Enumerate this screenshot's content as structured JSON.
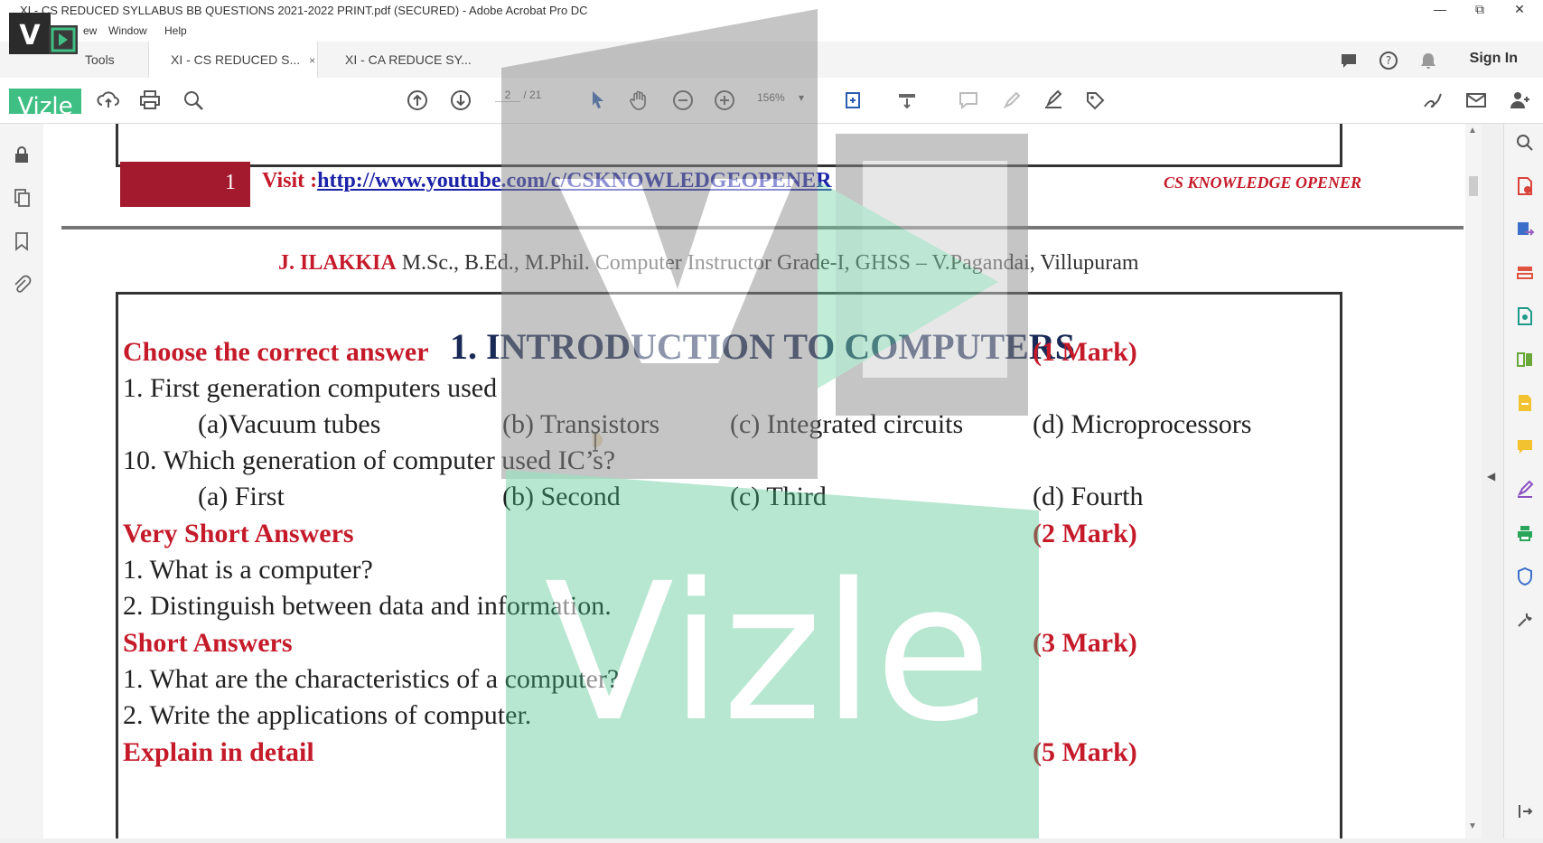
{
  "window": {
    "title": "XI - CS REDUCED SYLLABUS BB QUESTIONS 2021-2022 PRINT.pdf (SECURED) - Adobe Acrobat Pro DC",
    "minimize": "—",
    "maximize": "⧉",
    "close": "✕"
  },
  "menu": {
    "view": "ew",
    "window": "Window",
    "help": "Help"
  },
  "tabs": {
    "tools": "Tools",
    "doc1": "XI - CS REDUCED S...",
    "doc1_close": "×",
    "doc2": "XI - CA REDUCE SY..."
  },
  "header": {
    "sign_in": "Sign In"
  },
  "toolbar": {
    "page_current": "2",
    "page_total": "/ 21",
    "zoom": "156%"
  },
  "watermark": {
    "brand": "Vizle",
    "logo_letter": "V",
    "accent": "#3fbf84"
  },
  "document": {
    "page_number": "1",
    "visit_prefix": "Visit :",
    "visit_link": "http://www.youtube.com/c/CSKNOWLEDGEOPENER",
    "channel": "CS KNOWLEDGE OPENER",
    "author_name": "J. ILAKKIA",
    "author_details": "M.Sc., B.Ed., M.Phil. Computer Instructor Grade-I, GHSS – V.Pagandai, Villupuram",
    "chapter_title": "1. INTRODUCTION TO COMPUTERS",
    "sections": {
      "choose": {
        "title": "Choose the correct answer",
        "marks": "(1 Mark)"
      },
      "very_short": {
        "title": "Very Short Answers",
        "marks": "(2 Mark)"
      },
      "short": {
        "title": "Short Answers",
        "marks": "(3 Mark)"
      },
      "explain": {
        "title": "Explain in detail",
        "marks": "(5 Mark)"
      }
    },
    "mcq": [
      {
        "question": "1. First generation computers used",
        "options": [
          "(a)Vacuum tubes",
          "(b) Transistors",
          "(c) Integrated circuits",
          "(d) Microprocessors"
        ]
      },
      {
        "question": "10. Which generation of computer used IC’s?",
        "options": [
          "(a) First",
          "(b) Second",
          "(c) Third",
          "(d) Fourth"
        ]
      }
    ],
    "very_short_questions": [
      "1. What is a computer?",
      "2. Distinguish between data and information."
    ],
    "short_questions": [
      "1. What are the characteristics of a computer?",
      "2. Write the applications of computer."
    ]
  },
  "colors": {
    "section_red": "#c51a2a",
    "title_navy": "#1a2a56",
    "page_tag": "#a3192d",
    "link_blue": "#1b22a8"
  }
}
